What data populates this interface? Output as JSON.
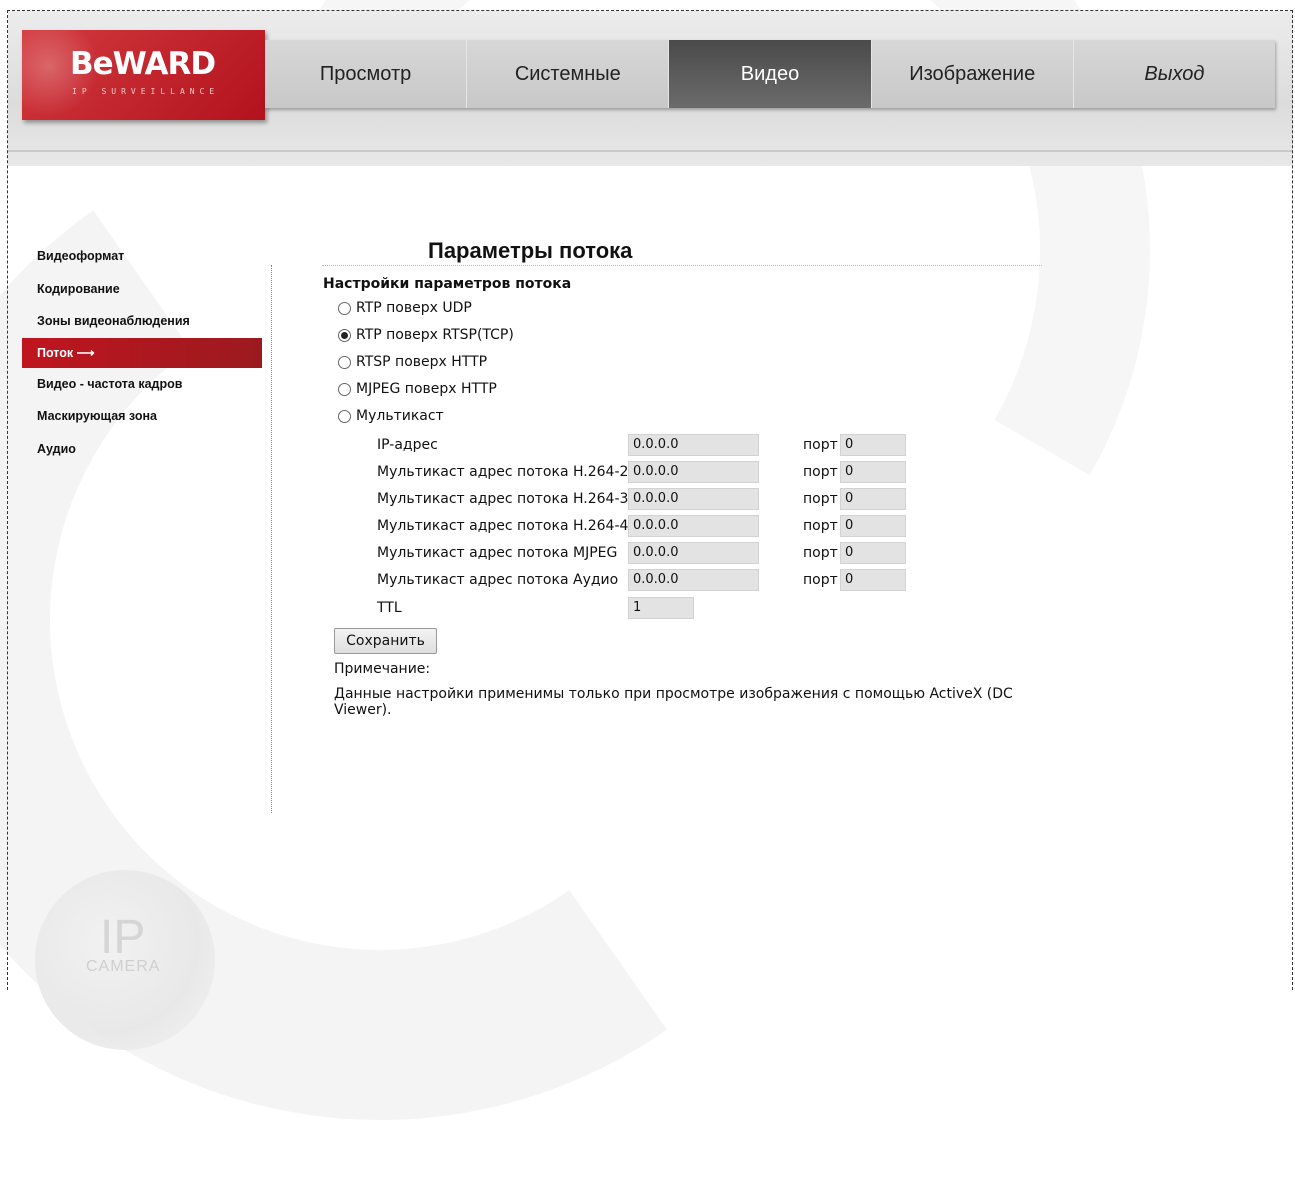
{
  "brand": {
    "name": "BeWARD",
    "tagline": "IP SURVEILLANCE"
  },
  "nav": {
    "items": [
      {
        "label": "Просмотр",
        "active": false
      },
      {
        "label": "Системные",
        "active": false
      },
      {
        "label": "Видео",
        "active": true
      },
      {
        "label": "Изображение",
        "active": false
      },
      {
        "label": "Выход",
        "active": false
      }
    ]
  },
  "sidebar": {
    "items": [
      {
        "label": "Видеоформат",
        "active": false
      },
      {
        "label": "Кодирование",
        "active": false
      },
      {
        "label": "Зоны видеонаблюдения",
        "active": false
      },
      {
        "label": "Поток",
        "active": true,
        "arrow": "⟶"
      },
      {
        "label": "Видео - частота кадров",
        "active": false
      },
      {
        "label": "Маскирующая зона",
        "active": false
      },
      {
        "label": "Аудио",
        "active": false
      }
    ]
  },
  "page": {
    "title": "Параметры потока",
    "section_title": "Настройки параметров потока",
    "radio_options": [
      {
        "label": "RTP поверх UDP",
        "checked": false
      },
      {
        "label": "RTP поверх RTSP(TCP)",
        "checked": true
      },
      {
        "label": "RTSP поверх HTTP",
        "checked": false
      },
      {
        "label": "MJPEG поверх HTTP",
        "checked": false
      },
      {
        "label": "Мультикаст",
        "checked": false
      }
    ],
    "multicast_rows": [
      {
        "label": "IP-адрес",
        "address": "0.0.0.0",
        "port_label": "порт",
        "port": "0"
      },
      {
        "label": "Мультикаст адрес потока H.264-2",
        "address": "0.0.0.0",
        "port_label": "порт",
        "port": "0"
      },
      {
        "label": "Мультикаст адрес потока H.264-3",
        "address": "0.0.0.0",
        "port_label": "порт",
        "port": "0"
      },
      {
        "label": "Мультикаст адрес потока H.264-4",
        "address": "0.0.0.0",
        "port_label": "порт",
        "port": "0"
      },
      {
        "label": "Мультикаст адрес потока MJPEG",
        "address": "0.0.0.0",
        "port_label": "порт",
        "port": "0"
      },
      {
        "label": "Мультикаст адрес потока Аудио",
        "address": "0.0.0.0",
        "port_label": "порт",
        "port": "0"
      }
    ],
    "ttl": {
      "label": "TTL",
      "value": "1"
    },
    "save_label": "Сохранить",
    "note_label": "Примечание:",
    "note_text": "Данные настройки применимы только при просмотре изображения с помощью ActiveX (DC Viewer)."
  },
  "watermark": {
    "ip": "IP",
    "camera": "CAMERA"
  },
  "colors": {
    "brand_red": "#c0151f",
    "active_tab": "#4a4a4a",
    "header_gray": "#dcdcdc"
  }
}
